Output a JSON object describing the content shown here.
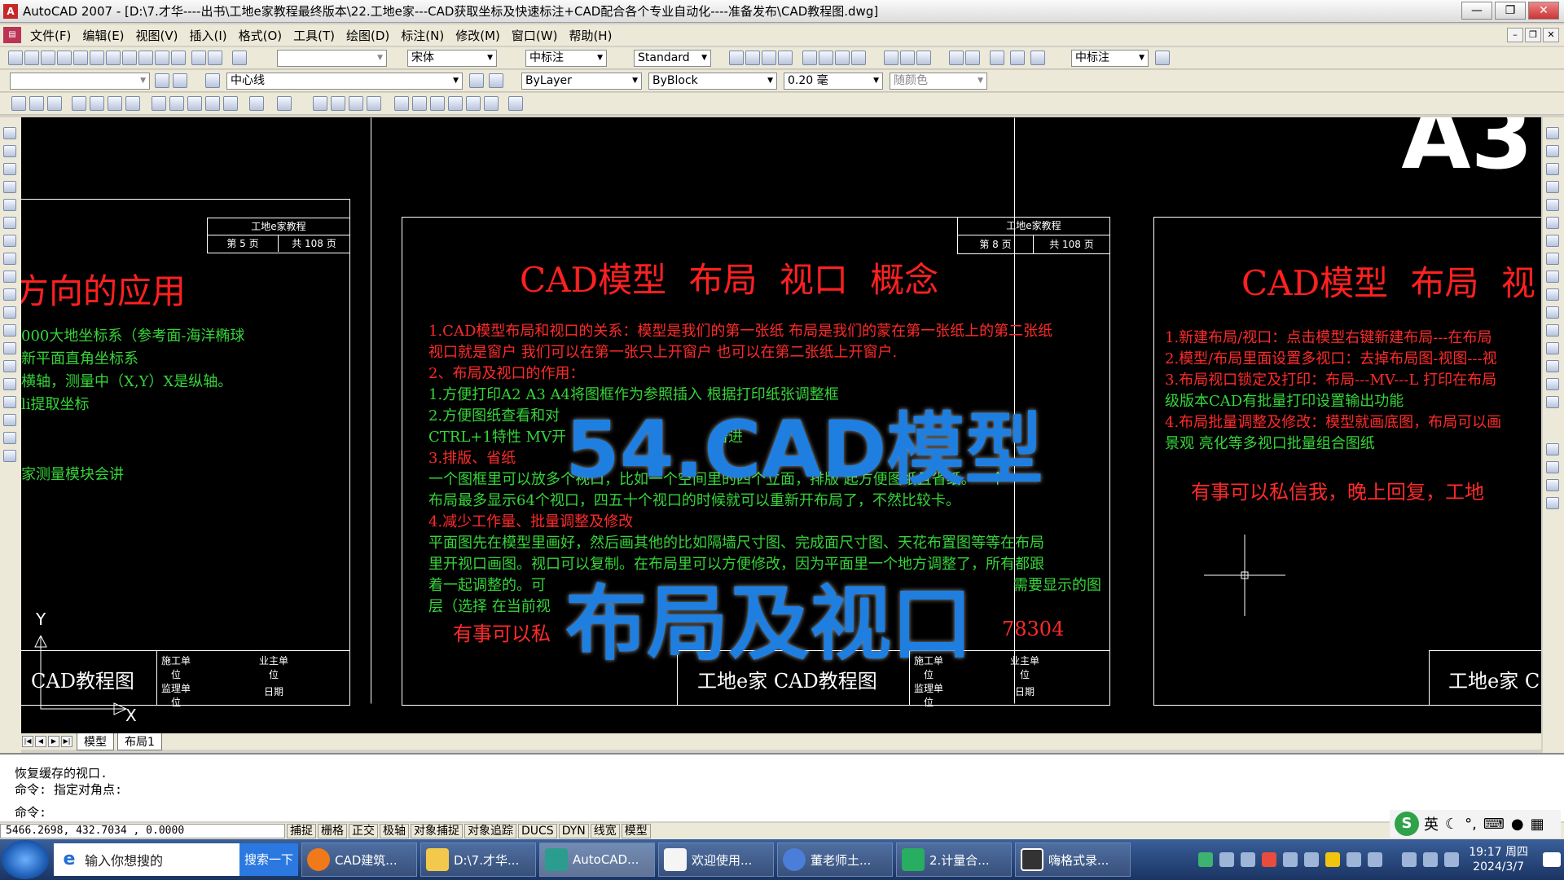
{
  "window": {
    "title": "AutoCAD 2007 - [D:\\7.才华----出书\\工地e家教程最终版本\\22.工地e家---CAD获取坐标及快速标注+CAD配合各个专业自动化----准备发布\\CAD教程图.dwg]",
    "min": "—",
    "max": "❐",
    "close": "✕"
  },
  "menu": [
    "文件(F)",
    "编辑(E)",
    "视图(V)",
    "插入(I)",
    "格式(O)",
    "工具(T)",
    "绘图(D)",
    "标注(N)",
    "修改(M)",
    "窗口(W)",
    "帮助(H)"
  ],
  "toolbar": {
    "font_style": "宋体",
    "dim_style": "中标注",
    "table_style": "Standard",
    "dim_style2": "中标注",
    "layer": "中心线",
    "color": "ByLayer",
    "linetype": "ByBlock",
    "lineweight": "0.20 毫",
    "plotstyle": "随颜色"
  },
  "drawing": {
    "a3_label": "A3",
    "left": {
      "title": "方向的应用",
      "tb_title": "工地e家教程",
      "page": "第 5 页",
      "total": "共 108 页",
      "lines": [
        "000大地坐标系（参考面-海洋椭球",
        "新平面直角坐标系",
        "横轴，测量中（X,Y）X是纵轴。",
        "li提取坐标",
        "家测量模块会讲"
      ],
      "footer": "CAD教程图",
      "c1": "施工单位",
      "c2": "业主单位",
      "c3": "监理单位",
      "c4": "日期",
      "y": "Y",
      "x": "X"
    },
    "mid": {
      "title": "CAD模型 布局 视口 概念",
      "tb_title": "工地e家教程",
      "page": "第 8 页",
      "total": "共 108 页",
      "l1": "1.CAD模型布局和视口的关系：模型是我们的第一张纸 布局是我们的蒙在第一张纸上的第二张纸",
      "l2": "视口就是窗户  我们可以在第一张只上开窗户  也可以在第二张纸上开窗户.",
      "l3": "2、布局及视口的作用：",
      "l4": "1.方便打印A2 A3 A4将图框作为参照插入  根据打印纸张调整框",
      "l5": "2.方便图纸查看和对",
      "l6": "CTRL+1特性  MV开",
      "l6b": "击进",
      "l7": "3.排版、省纸",
      "l8": "一个图框里可以放多个视口，比如一个空间里的四个立面，排版       起方便图纸且省纸。一个",
      "l9": "布局最多显示64个视口，四五十个视口的时候就可以重新开布局了，不然比较卡。",
      "l10": "4.减少工作量、批量调整及修改",
      "l11": "平面图先在模型里画好，然后画其他的比如隔墙尺寸图、完成面尺寸图、天花布置图等等在布局",
      "l12": "里开视口画图。视口可以复制。在布局里可以方便修改，因为平面里一个地方调整了，所有都跟",
      "l13": "着一起调整的。可",
      "l13b": "需要显示的图",
      "l14": "层（选择 在当前视",
      "l15": "有事可以私",
      "l15b": "78304",
      "footer": "工地e家 CAD教程图",
      "c1": "施工单位",
      "c2": "业主单位",
      "c3": "监理单位",
      "c4": "日期"
    },
    "right": {
      "title": "CAD模型 布局 视",
      "l1": "1.新建布局/视口：点击模型右键新建布局---在布局",
      "l2": "2.模型/布局里面设置多视口：去掉布局图-视图---视",
      "l3": "3.布局视口锁定及打印：布局---MV---L 打印在布局",
      "l4": "级版本CAD有批量打印设置输出功能",
      "l5": "4.布局批量调整及修改：模型就画底图，布局可以画",
      "l6": "景观 亮化等多视口批量组合图纸",
      "l7": "有事可以私信我，晚上回复，工地",
      "footer": "工地e家 C"
    }
  },
  "overlay": {
    "line1": "54.CAD模型",
    "line2": "布局及视口"
  },
  "tabs": {
    "model": "模型",
    "layout": "布局1"
  },
  "command": {
    "l1": "恢复缓存的视口.",
    "l2": "命令: 指定对角点:",
    "l3": "命令:"
  },
  "status": {
    "coords": "5466.2698,   432.7034   , 0.0000",
    "buttons": [
      "捕捉",
      "栅格",
      "正交",
      "极轴",
      "对象捕捉",
      "对象追踪",
      "DUCS",
      "DYN",
      "线宽",
      "模型"
    ]
  },
  "ime": {
    "lang": "英"
  },
  "taskbar": {
    "search_placeholder": "输入你想搜的",
    "search_btn": "搜索一下",
    "tasks": [
      "CAD建筑...",
      "D:\\7.才华...",
      "AutoCAD...",
      "欢迎使用...",
      "董老师土...",
      "2.计量合...",
      "嗨格式录..."
    ],
    "time": "19:17 周四",
    "date": "2024/3/7"
  },
  "colors": {
    "red": "#ff2a2a",
    "green": "#36d43a",
    "overlay": "#1e7fe0"
  }
}
